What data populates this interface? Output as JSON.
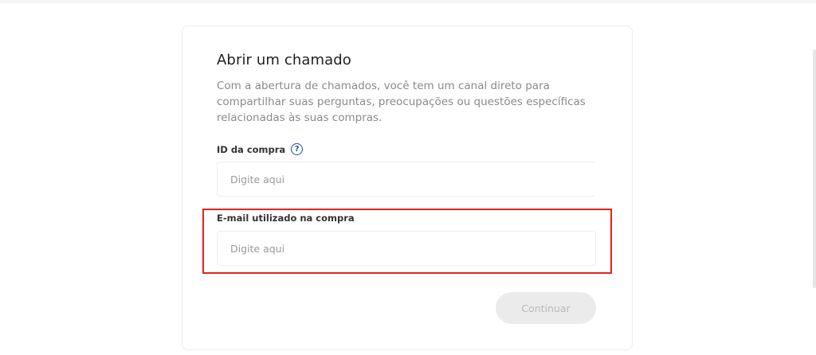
{
  "form": {
    "title": "Abrir um chamado",
    "description": "Com a abertura de chamados, você tem um canal direto para compartilhar suas perguntas, preocupações ou questões específicas relacionadas às suas compras.",
    "purchase_id": {
      "label": "ID da compra",
      "help_glyph": "?",
      "placeholder": "Digite aqui",
      "value": ""
    },
    "email": {
      "label": "E-mail utilizado na compra",
      "placeholder": "Digite aqui",
      "value": ""
    },
    "submit_label": "Continuar",
    "submit_enabled": false
  },
  "colors": {
    "title": "#1f1f1f",
    "description": "#8a8a8a",
    "help_icon": "#1f4fa6",
    "highlight": "#e8231b",
    "button_disabled_bg": "#ebebeb",
    "button_disabled_text": "#b8b8b8"
  },
  "icons": {
    "help": "question-circle-icon"
  }
}
